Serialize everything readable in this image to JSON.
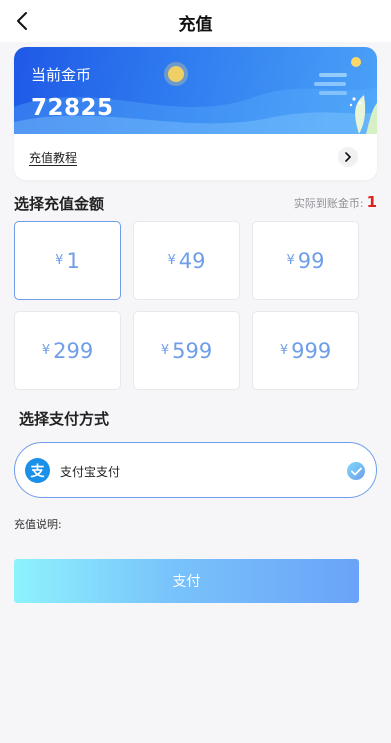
{
  "header": {
    "title": "充值",
    "back_icon": "chevron-left-icon"
  },
  "balance_card": {
    "label": "当前金币",
    "value": "72825",
    "tutorial_link": "充值教程",
    "tutorial_icon": "chevron-right-icon"
  },
  "amount_section": {
    "title": "选择充值金额",
    "actual_label": "实际到账金币:",
    "actual_value": "1",
    "currency_symbol": "¥",
    "options": [
      {
        "amount": "1",
        "selected": true
      },
      {
        "amount": "49",
        "selected": false
      },
      {
        "amount": "99",
        "selected": false
      },
      {
        "amount": "299",
        "selected": false
      },
      {
        "amount": "599",
        "selected": false
      },
      {
        "amount": "999",
        "selected": false
      }
    ]
  },
  "payment_section": {
    "title": "选择支付方式",
    "methods": [
      {
        "label": "支付宝支付",
        "icon": "alipay-icon",
        "icon_glyph": "支",
        "selected": true
      }
    ]
  },
  "note": {
    "label": "充值说明:"
  },
  "pay_button": {
    "label": "支付"
  },
  "colors": {
    "accent": "#6f9ee9",
    "actual_value": "#e02020",
    "card_gradient_start": "#1f59e6",
    "card_gradient_end": "#4ba2f7",
    "button_gradient_start": "#8ef3fd",
    "button_gradient_end": "#6aa3f8"
  }
}
